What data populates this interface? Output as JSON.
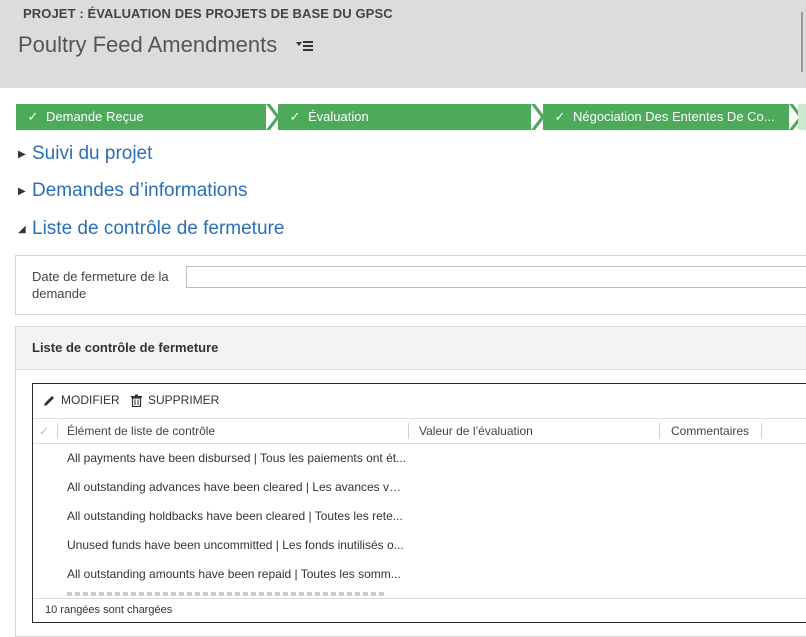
{
  "header": {
    "project_label": "PROJET : ÉVALUATION DES PROJETS DE BASE DU GPSC",
    "record_title": "Poultry Feed Amendments",
    "menu_icon": "list-menu-icon"
  },
  "process_stages": [
    {
      "label": "Demande Reçue",
      "status": "completed"
    },
    {
      "label": "Évaluation",
      "status": "completed"
    },
    {
      "label": "Négociation Des Ententes De Co...",
      "status": "completed"
    }
  ],
  "sections": {
    "suivi": {
      "label": "Suivi du projet",
      "expanded": false
    },
    "demandes": {
      "label": "Demandes d’informations",
      "expanded": false
    },
    "liste": {
      "label": "Liste de contrôle de fermeture",
      "expanded": true
    }
  },
  "date_field": {
    "label": "Date de fermeture de la demande",
    "value": ""
  },
  "checklist_panel": {
    "title": "Liste de contrôle de fermeture",
    "commands": {
      "edit": "MODIFIER",
      "delete": "SUPPRIMER"
    },
    "columns": {
      "item": "Élément de liste de contrôle",
      "value": "Valeur de l’évaluation",
      "comments": "Commentaires"
    },
    "rows": [
      {
        "item": "All payments have been disbursed | Tous les paiements ont ét..."
      },
      {
        "item": "All outstanding advances have been cleared | Les avances ver..."
      },
      {
        "item": "All outstanding holdbacks have been cleared | Toutes les rete..."
      },
      {
        "item": "Unused funds have been uncommitted | Les fonds inutilisés o..."
      },
      {
        "item": "All outstanding amounts have been repaid | Toutes les somm..."
      }
    ],
    "footer": "10 rangées sont chargées"
  },
  "colors": {
    "stage_green": "#4caa5a",
    "link_blue": "#2a6fb5",
    "header_gray": "#dcdcdc"
  }
}
